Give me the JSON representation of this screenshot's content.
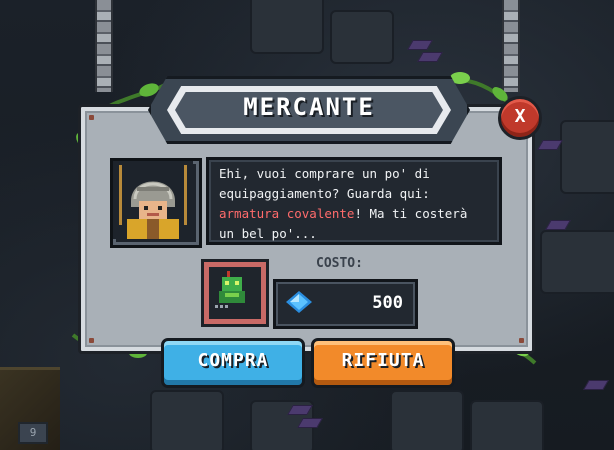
{
  "dialog": {
    "title": "MERCANTE",
    "close_label": "X",
    "message_before": "Ehi, vuoi comprare un po' di equipaggiamento? Guarda qui: ",
    "message_highlight": "armatura covalente",
    "message_after": "! Ma ti costerà un bel po'...",
    "cost_label": "COSTO:",
    "cost_value": "500",
    "buy_label": "COMPRA",
    "refuse_label": "RIFIUTA"
  },
  "hud": {
    "corner_number": "9"
  },
  "icons": {
    "currency": "blue-gem-icon",
    "item": "green-goblin-armor-icon",
    "portrait": "merchant-portrait"
  },
  "colors": {
    "buy_button": "#3fb0e6",
    "refuse_button": "#f28a2a",
    "close_button": "#c0392b",
    "highlight_text": "#ff6b6b",
    "panel": "#a9b0b7"
  }
}
